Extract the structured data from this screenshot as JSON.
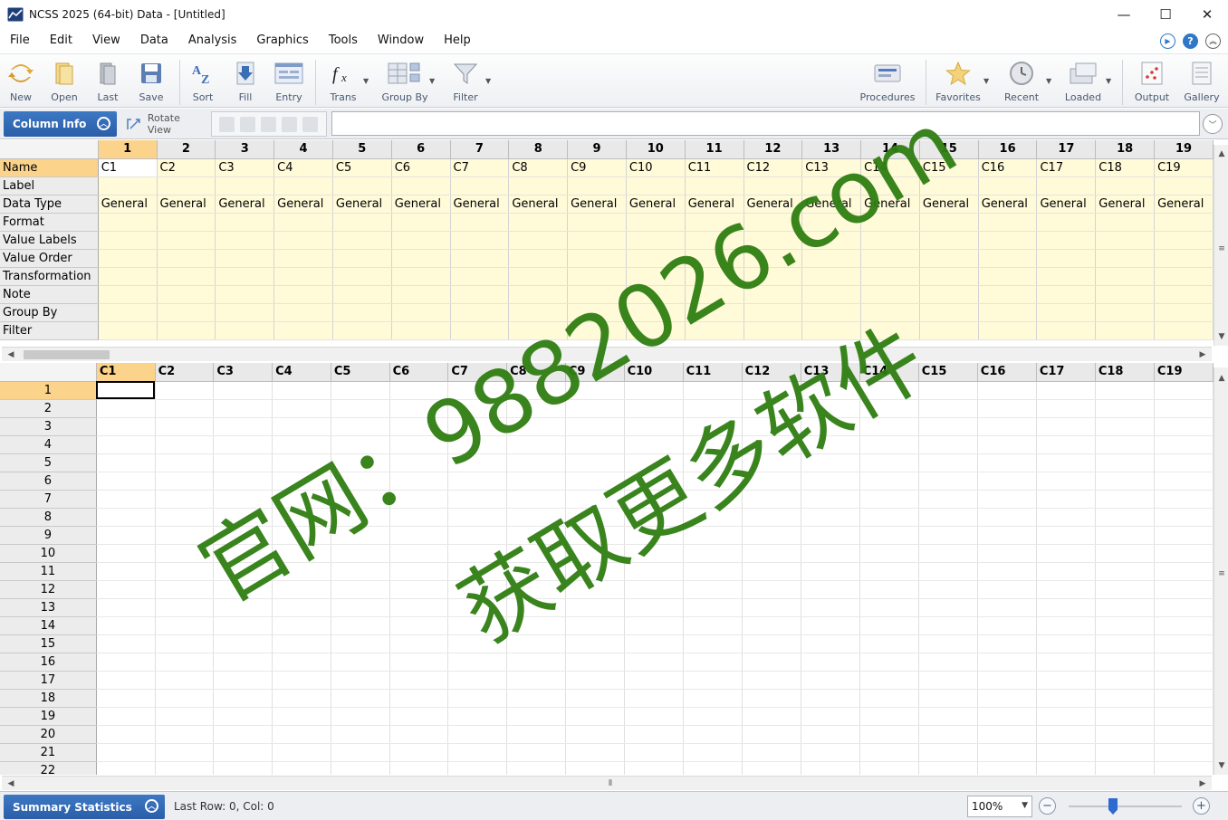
{
  "window": {
    "title": "NCSS 2025 (64-bit) Data - [Untitled]",
    "controls": {
      "minimize": "—",
      "maximize": "☐",
      "close": "✕"
    }
  },
  "menu": {
    "items": [
      "File",
      "Edit",
      "View",
      "Data",
      "Analysis",
      "Graphics",
      "Tools",
      "Window",
      "Help"
    ],
    "right_icons": [
      "play-icon",
      "help-icon",
      "collapse-icon"
    ]
  },
  "toolbar": {
    "new_label": "New",
    "open_label": "Open",
    "last_label": "Last",
    "save_label": "Save",
    "sort_label": "Sort",
    "fill_label": "Fill",
    "entry_label": "Entry",
    "trans_label": "Trans",
    "groupby_label": "Group By",
    "filter_label": "Filter",
    "procedures_label": "Procedures",
    "favorites_label": "Favorites",
    "recent_label": "Recent",
    "loaded_label": "Loaded",
    "output_label": "Output",
    "gallery_label": "Gallery"
  },
  "ribbon": {
    "column_info_label": "Column Info",
    "rotate_view_label": "Rotate View",
    "formula_value": ""
  },
  "column_info_grid": {
    "column_numbers": [
      "1",
      "2",
      "3",
      "4",
      "5",
      "6",
      "7",
      "8",
      "9",
      "10",
      "11",
      "12",
      "13",
      "14",
      "15",
      "16",
      "17",
      "18",
      "19"
    ],
    "row_labels": [
      "Name",
      "Label",
      "Data Type",
      "Format",
      "Value Labels",
      "Value Order",
      "Transformation",
      "Note",
      "Group By",
      "Filter"
    ],
    "names": [
      "C1",
      "C2",
      "C3",
      "C4",
      "C5",
      "C6",
      "C7",
      "C8",
      "C9",
      "C10",
      "C11",
      "C12",
      "C13",
      "C14",
      "C15",
      "C16",
      "C17",
      "C18",
      "C19"
    ],
    "data_type_value": "General"
  },
  "data_grid": {
    "column_names": [
      "C1",
      "C2",
      "C3",
      "C4",
      "C5",
      "C6",
      "C7",
      "C8",
      "C9",
      "C10",
      "C11",
      "C12",
      "C13",
      "C14",
      "C15",
      "C16",
      "C17",
      "C18",
      "C19"
    ],
    "row_numbers": [
      "1",
      "2",
      "3",
      "4",
      "5",
      "6",
      "7",
      "8",
      "9",
      "10",
      "11",
      "12",
      "13",
      "14",
      "15",
      "16",
      "17",
      "18",
      "19",
      "20",
      "21",
      "22"
    ],
    "active_cell": "C1 row 1"
  },
  "statusbar": {
    "summary_label": "Summary Statistics",
    "status_text": "Last Row: 0, Col: 0",
    "zoom_value": "100%"
  },
  "watermark": {
    "line1": "官网：9882026.com",
    "line2": "获取更多软件",
    "color": "#2f7d12"
  }
}
